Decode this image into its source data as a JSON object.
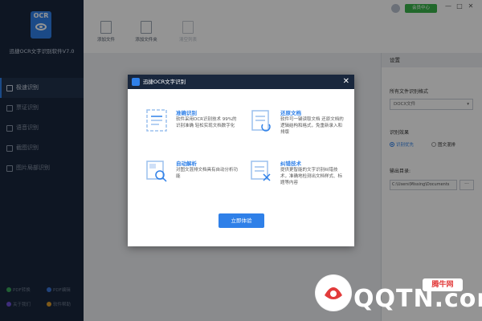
{
  "app": {
    "logo_text": "OCR",
    "name": "迅捷OCR文字识别软件V7.0"
  },
  "sidebar": {
    "items": [
      {
        "label": "极速识别",
        "active": true
      },
      {
        "label": "票证识别"
      },
      {
        "label": "语音识别"
      },
      {
        "label": "截图识别"
      },
      {
        "label": "图片局部识别"
      }
    ],
    "bottom_links": [
      {
        "label": "PDF转换",
        "color": "#3aa55b"
      },
      {
        "label": "PDF编辑",
        "color": "#3a74d4"
      },
      {
        "label": "关于我们",
        "color": "#6b4fd4"
      },
      {
        "label": "软件帮助",
        "color": "#d99a2b"
      }
    ]
  },
  "toolbar": {
    "add_file": "添加文件",
    "add_folder": "添加文件夹",
    "clear_list": "清空列表"
  },
  "header": {
    "member_center": "会员中心",
    "win_min": "—",
    "win_max": "□",
    "win_close": "✕"
  },
  "settings": {
    "title": "设置",
    "format_label": "所有文件识别格式",
    "format_value": "DOCX文件",
    "effect_label": "识别效果",
    "radio_priority": "识别优先",
    "radio_layout": "图文混排",
    "output_label": "输出目录:",
    "output_path": "C:\\Users\\Missing\\Documents",
    "browse": "···"
  },
  "modal": {
    "title": "迅捷OCR文字识别",
    "close": "✕",
    "features": [
      {
        "title": "准确识别",
        "desc": "软件采用OCR识别技术 99%的识别准确 轻松实现文档数字化"
      },
      {
        "title": "还原文档",
        "desc": "软件可一键读取文档 还原文档的逻辑结构和格式，免重新录入和排版"
      },
      {
        "title": "自动解析",
        "desc": "对图文混排文档具有自动分析功能"
      },
      {
        "title": "纠错技术",
        "desc": "提供更智能的文字识别纠错技术，准确地检测出文档样式、标题等内容"
      }
    ],
    "cta": "立即体验"
  },
  "watermark": {
    "text": "QQTN.com",
    "badge": "腾牛网"
  },
  "colors": {
    "accent": "#2f80e8",
    "sidebar_bg": "#19273d",
    "member": "#39b44a"
  }
}
